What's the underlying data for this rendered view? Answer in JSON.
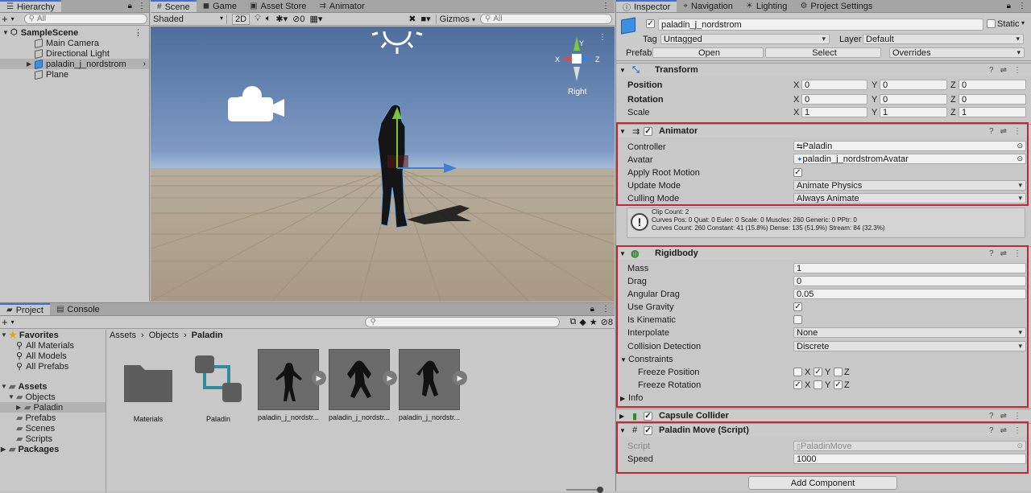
{
  "hierarchy": {
    "tab": "Hierarchy",
    "search_placeholder": "All",
    "scene": "SampleScene",
    "items": [
      "Main Camera",
      "Directional Light",
      "paladin_j_nordstrom",
      "Plane"
    ]
  },
  "scene_tabs": [
    "Scene",
    "Game",
    "Asset Store",
    "Animator"
  ],
  "scene_toolbar": {
    "shading": "Shaded",
    "mode_2d": "2D",
    "hidden_count": "0",
    "gizmos": "Gizmos",
    "search_placeholder": "All",
    "gizmo_label": "Right",
    "gizmo_x": "X",
    "gizmo_y": "Y",
    "gizmo_z": "Z"
  },
  "project": {
    "tabs": [
      "Project",
      "Console"
    ],
    "favorites_label": "Favorites",
    "favorites": [
      "All Materials",
      "All Models",
      "All Prefabs"
    ],
    "assets_label": "Assets",
    "asset_tree": [
      "Objects",
      "Paladin",
      "Prefabs",
      "Scenes",
      "Scripts"
    ],
    "packages_label": "Packages",
    "breadcrumb": [
      "Assets",
      "Objects",
      "Paladin"
    ],
    "hidden_count": "8",
    "assets": [
      "Materials",
      "Paladin",
      "paladin_j_nordstr...",
      "paladin_j_nordstr...",
      "paladin_j_nordstr..."
    ]
  },
  "inspector": {
    "tabs": [
      "Inspector",
      "Navigation",
      "Lighting",
      "Project Settings"
    ],
    "object_name": "paladin_j_nordstrom",
    "static_label": "Static",
    "tag_label": "Tag",
    "tag_value": "Untagged",
    "layer_label": "Layer",
    "layer_value": "Default",
    "prefab_label": "Prefab",
    "prefab_open": "Open",
    "prefab_select": "Select",
    "prefab_overrides": "Overrides",
    "transform": {
      "title": "Transform",
      "position_label": "Position",
      "rotation_label": "Rotation",
      "scale_label": "Scale",
      "axis_x": "X",
      "axis_y": "Y",
      "axis_z": "Z",
      "position": [
        "0",
        "0",
        "0"
      ],
      "rotation": [
        "0",
        "0",
        "0"
      ],
      "scale": [
        "1",
        "1",
        "1"
      ]
    },
    "animator": {
      "title": "Animator",
      "controller_label": "Controller",
      "controller_value": "Paladin",
      "avatar_label": "Avatar",
      "avatar_value": "paladin_j_nordstromAvatar",
      "apply_root_label": "Apply Root Motion",
      "update_mode_label": "Update Mode",
      "update_mode_value": "Animate Physics",
      "culling_label": "Culling Mode",
      "culling_value": "Always Animate",
      "info_line1": "Clip Count: 2",
      "info_line2": "Curves Pos: 0 Quat: 0 Euler: 0 Scale: 0 Muscles: 260 Generic: 0 PPtr: 0",
      "info_line3": "Curves Count: 260 Constant: 41 (15.8%) Dense: 135 (51.9%) Stream: 84 (32.3%)"
    },
    "rigidbody": {
      "title": "Rigidbody",
      "mass_label": "Mass",
      "mass": "1",
      "drag_label": "Drag",
      "drag": "0",
      "angular_drag_label": "Angular Drag",
      "angular_drag": "0.05",
      "use_gravity_label": "Use Gravity",
      "kinematic_label": "Is Kinematic",
      "interpolate_label": "Interpolate",
      "interpolate": "None",
      "collision_label": "Collision Detection",
      "collision": "Discrete",
      "constraints_label": "Constraints",
      "freeze_pos_label": "Freeze Position",
      "freeze_rot_label": "Freeze Rotation",
      "info_label": "Info"
    },
    "capsule_title": "Capsule Collider",
    "paladin_move": {
      "title": "Paladin Move (Script)",
      "script_label": "Script",
      "script_value": "PaladinMove",
      "speed_label": "Speed",
      "speed": "1000"
    },
    "add_component": "Add Component"
  }
}
